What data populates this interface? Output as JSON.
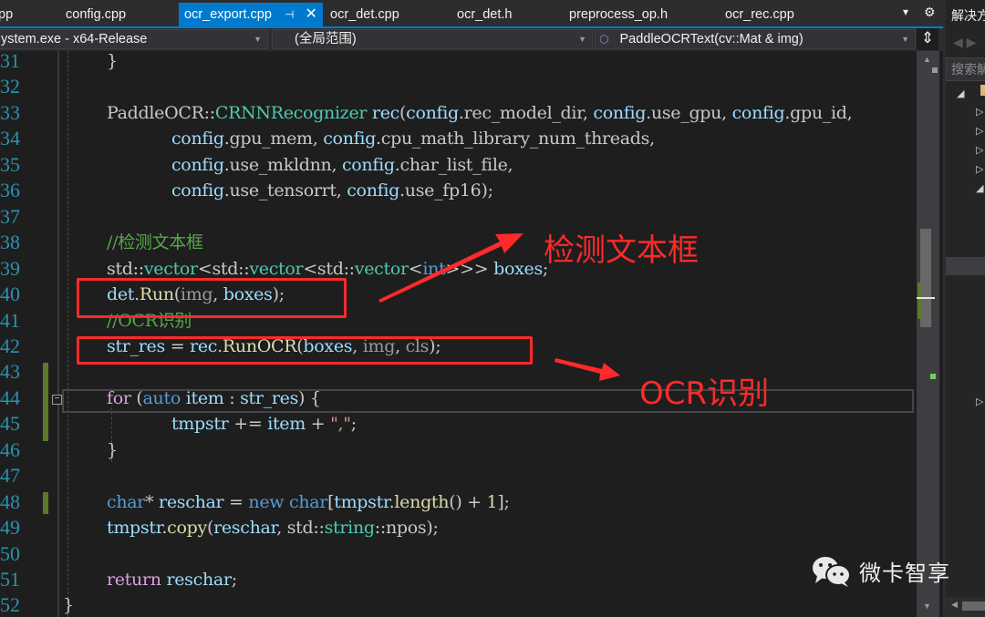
{
  "tabs": [
    {
      "label": "pp",
      "active": false
    },
    {
      "label": "config.cpp",
      "active": false
    },
    {
      "label": "ocr_export.cpp",
      "active": true,
      "pin_icon": "pin-icon",
      "close_icon": "close-icon"
    },
    {
      "label": "ocr_det.cpp",
      "active": false
    },
    {
      "label": "ocr_det.h",
      "active": false
    },
    {
      "label": "preprocess_op.h",
      "active": false
    },
    {
      "label": "ocr_rec.cpp",
      "active": false
    }
  ],
  "tab_icons": {
    "overflow": "▾",
    "settings": "⚙",
    "pin": "⊣",
    "close": "✕"
  },
  "navbar": {
    "project": "ystem.exe - x64-Release",
    "scope": "(全局范围)",
    "member": "PaddleOCRText(cv::Mat & img)",
    "member_icon": "⬡",
    "split": "⇕"
  },
  "editor": {
    "lines": [
      {
        "num": "31",
        "tokens": [
          {
            "t": "}",
            "c": "plain"
          }
        ]
      },
      {
        "num": "32",
        "tokens": []
      },
      {
        "num": "33",
        "tokens": [
          {
            "t": "PaddleOCR::",
            "c": "plain"
          },
          {
            "t": "CRNNRecognizer",
            "c": "type"
          },
          {
            "t": " rec",
            "c": "var"
          },
          {
            "t": "(",
            "c": "plain"
          },
          {
            "t": "config",
            "c": "var"
          },
          {
            "t": ".rec_model_dir, ",
            "c": "plain"
          },
          {
            "t": "config",
            "c": "var"
          },
          {
            "t": ".use_gpu, ",
            "c": "plain"
          },
          {
            "t": "config",
            "c": "var"
          },
          {
            "t": ".gpu_id,",
            "c": "plain"
          }
        ]
      },
      {
        "num": "34",
        "tokens": [
          {
            "t": "    config",
            "c": "var"
          },
          {
            "t": ".gpu_mem, ",
            "c": "plain"
          },
          {
            "t": "config",
            "c": "var"
          },
          {
            "t": ".cpu_math_library_num_threads,",
            "c": "plain"
          }
        ]
      },
      {
        "num": "35",
        "tokens": [
          {
            "t": "    config",
            "c": "var"
          },
          {
            "t": ".use_mkldnn, ",
            "c": "plain"
          },
          {
            "t": "config",
            "c": "var"
          },
          {
            "t": ".char_list_file,",
            "c": "plain"
          }
        ]
      },
      {
        "num": "36",
        "tokens": [
          {
            "t": "    config",
            "c": "var"
          },
          {
            "t": ".use_tensorrt, ",
            "c": "plain"
          },
          {
            "t": "config",
            "c": "var"
          },
          {
            "t": ".use_fp16);",
            "c": "plain"
          }
        ]
      },
      {
        "num": "37",
        "tokens": []
      },
      {
        "num": "38",
        "tokens": [
          {
            "t": "//检测文本框",
            "c": "cmt"
          }
        ]
      },
      {
        "num": "39",
        "tokens": [
          {
            "t": "std::",
            "c": "plain"
          },
          {
            "t": "vector",
            "c": "type"
          },
          {
            "t": "<std::",
            "c": "plain"
          },
          {
            "t": "vector",
            "c": "type"
          },
          {
            "t": "<std::",
            "c": "plain"
          },
          {
            "t": "vector",
            "c": "type"
          },
          {
            "t": "<",
            "c": "plain"
          },
          {
            "t": "int",
            "c": "kw"
          },
          {
            "t": ">>> ",
            "c": "plain"
          },
          {
            "t": "boxes",
            "c": "var"
          },
          {
            "t": ";",
            "c": "plain"
          }
        ]
      },
      {
        "num": "40",
        "tokens": [
          {
            "t": "det",
            "c": "var"
          },
          {
            "t": ".",
            "c": "plain"
          },
          {
            "t": "Run",
            "c": "fn"
          },
          {
            "t": "(",
            "c": "plain"
          },
          {
            "t": "img",
            "c": "param"
          },
          {
            "t": ", ",
            "c": "plain"
          },
          {
            "t": "boxes",
            "c": "var"
          },
          {
            "t": ");",
            "c": "plain"
          }
        ]
      },
      {
        "num": "41",
        "tokens": [
          {
            "t": "//OCR识别",
            "c": "cmt"
          }
        ]
      },
      {
        "num": "42",
        "tokens": [
          {
            "t": "str_res",
            "c": "var"
          },
          {
            "t": " = ",
            "c": "plain"
          },
          {
            "t": "rec",
            "c": "var"
          },
          {
            "t": ".",
            "c": "plain"
          },
          {
            "t": "RunOCR",
            "c": "fn"
          },
          {
            "t": "(",
            "c": "plain"
          },
          {
            "t": "boxes",
            "c": "var"
          },
          {
            "t": ", ",
            "c": "plain"
          },
          {
            "t": "img",
            "c": "param"
          },
          {
            "t": ", ",
            "c": "plain"
          },
          {
            "t": "cls",
            "c": "param"
          },
          {
            "t": ");",
            "c": "plain"
          }
        ]
      },
      {
        "num": "43",
        "tokens": []
      },
      {
        "num": "44",
        "tokens": [
          {
            "t": "for",
            "c": "ctl"
          },
          {
            "t": " (",
            "c": "plain"
          },
          {
            "t": "auto",
            "c": "kw"
          },
          {
            "t": " item",
            "c": "var"
          },
          {
            "t": " : ",
            "c": "plain"
          },
          {
            "t": "str_res",
            "c": "var"
          },
          {
            "t": ") {",
            "c": "plain"
          }
        ]
      },
      {
        "num": "45",
        "tokens": [
          {
            "t": "    tmpstr",
            "c": "var"
          },
          {
            "t": " += ",
            "c": "plain"
          },
          {
            "t": "item",
            "c": "var"
          },
          {
            "t": " + ",
            "c": "plain"
          },
          {
            "t": "\",\"",
            "c": "str"
          },
          {
            "t": ";",
            "c": "plain"
          }
        ]
      },
      {
        "num": "46",
        "tokens": [
          {
            "t": "}",
            "c": "plain"
          }
        ]
      },
      {
        "num": "47",
        "tokens": []
      },
      {
        "num": "48",
        "tokens": [
          {
            "t": "char",
            "c": "kw"
          },
          {
            "t": "* ",
            "c": "plain"
          },
          {
            "t": "reschar",
            "c": "var"
          },
          {
            "t": " = ",
            "c": "plain"
          },
          {
            "t": "new",
            "c": "kw"
          },
          {
            "t": " ",
            "c": "plain"
          },
          {
            "t": "char",
            "c": "kw"
          },
          {
            "t": "[",
            "c": "plain"
          },
          {
            "t": "tmpstr",
            "c": "var"
          },
          {
            "t": ".",
            "c": "plain"
          },
          {
            "t": "length",
            "c": "fn"
          },
          {
            "t": "() + ",
            "c": "plain"
          },
          {
            "t": "1",
            "c": "fn"
          },
          {
            "t": "];",
            "c": "plain"
          }
        ]
      },
      {
        "num": "49",
        "tokens": [
          {
            "t": "tmpstr",
            "c": "var"
          },
          {
            "t": ".",
            "c": "plain"
          },
          {
            "t": "copy",
            "c": "fn"
          },
          {
            "t": "(",
            "c": "plain"
          },
          {
            "t": "reschar",
            "c": "var"
          },
          {
            "t": ", std::",
            "c": "plain"
          },
          {
            "t": "string",
            "c": "type"
          },
          {
            "t": "::npos);",
            "c": "plain"
          }
        ]
      },
      {
        "num": "50",
        "tokens": []
      },
      {
        "num": "51",
        "tokens": [
          {
            "t": "return",
            "c": "ctl"
          },
          {
            "t": " reschar",
            "c": "var"
          },
          {
            "t": ";",
            "c": "plain"
          }
        ]
      },
      {
        "num": "52",
        "tokens": []
      }
    ],
    "line_indent": [
      0,
      0,
      0,
      1,
      1,
      1,
      0,
      0,
      0,
      0,
      0,
      0,
      0,
      0,
      1,
      0,
      0,
      0,
      0,
      0,
      0,
      -1
    ]
  },
  "annotations": {
    "detect_label": "检测文本框",
    "ocr_label": "OCR识别",
    "color": "#ff2a2a"
  },
  "solution_explorer": {
    "title": "解决方案资源管理器",
    "search_placeholder": "搜索解决方案资源管理器",
    "nav_icons": "◀ ▶"
  },
  "watermark": {
    "text": "微卡智享",
    "icon": "wechat-icon"
  }
}
